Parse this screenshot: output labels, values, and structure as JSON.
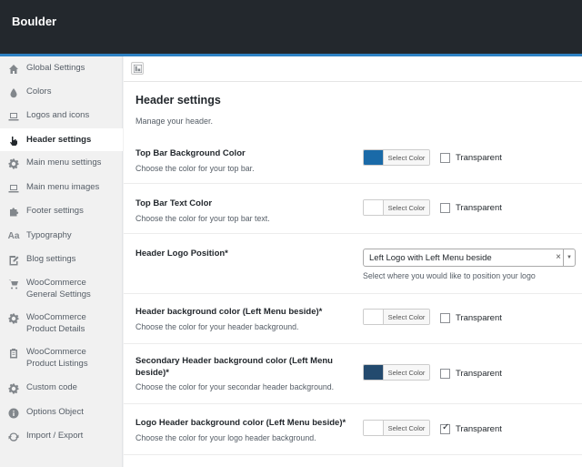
{
  "app": {
    "title": "Boulder"
  },
  "sidebar": {
    "items": [
      {
        "label": "Global Settings",
        "icon": "home-icon",
        "active": false
      },
      {
        "label": "Colors",
        "icon": "drop-icon",
        "active": false
      },
      {
        "label": "Logos and icons",
        "icon": "laptop-icon",
        "active": false
      },
      {
        "label": "Header settings",
        "icon": "hand-pointer-icon",
        "active": true
      },
      {
        "label": "Main menu settings",
        "icon": "gear-icon",
        "active": false
      },
      {
        "label": "Main menu images",
        "icon": "laptop-icon",
        "active": false
      },
      {
        "label": "Footer settings",
        "icon": "puzzle-icon",
        "active": false
      },
      {
        "label": "Typography",
        "icon": "typography-icon",
        "active": false,
        "glyph": "Aa"
      },
      {
        "label": "Blog settings",
        "icon": "edit-icon",
        "active": false
      },
      {
        "label": "WooCommerce General Settings",
        "icon": "cart-icon",
        "active": false
      },
      {
        "label": "WooCommerce Product Details",
        "icon": "gear-icon",
        "active": false
      },
      {
        "label": "WooCommerce Product Listings",
        "icon": "clipboard-icon",
        "active": false
      },
      {
        "label": "Custom code",
        "icon": "gear-icon",
        "active": false
      },
      {
        "label": "Options Object",
        "icon": "info-icon",
        "active": false
      },
      {
        "label": "Import / Export",
        "icon": "refresh-icon",
        "active": false
      }
    ]
  },
  "toolbar": {
    "icon": "panel-icon"
  },
  "main": {
    "title": "Header settings",
    "description": "Manage your header.",
    "select_color_label": "Select Color",
    "transparent_label": "Transparent",
    "fields": {
      "top_bar_bg": {
        "label": "Top Bar Background Color",
        "desc": "Choose the color for your top bar.",
        "color": "#1a6aa8",
        "transparent": false
      },
      "top_bar_text": {
        "label": "Top Bar Text Color",
        "desc": "Choose the color for your top bar text.",
        "color": "#ffffff",
        "transparent": false
      },
      "logo_position": {
        "label": "Header Logo Position*",
        "value": "Left Logo with Left Menu beside",
        "help": "Select where you would like to position your logo"
      },
      "header_bg": {
        "label": "Header background color (Left Menu beside)*",
        "desc": "Choose the color for your header background.",
        "color": "#ffffff",
        "transparent": false
      },
      "secondary_bg": {
        "label": "Secondary Header background color (Left Menu beside)*",
        "desc": "Choose the color for your secondar header background.",
        "color": "#234a6e",
        "transparent": false
      },
      "logo_header_bg": {
        "label": "Logo Header background color (Left Menu beside)*",
        "desc": "Choose the color for your logo header background.",
        "color": "#ffffff",
        "transparent": true
      }
    }
  }
}
